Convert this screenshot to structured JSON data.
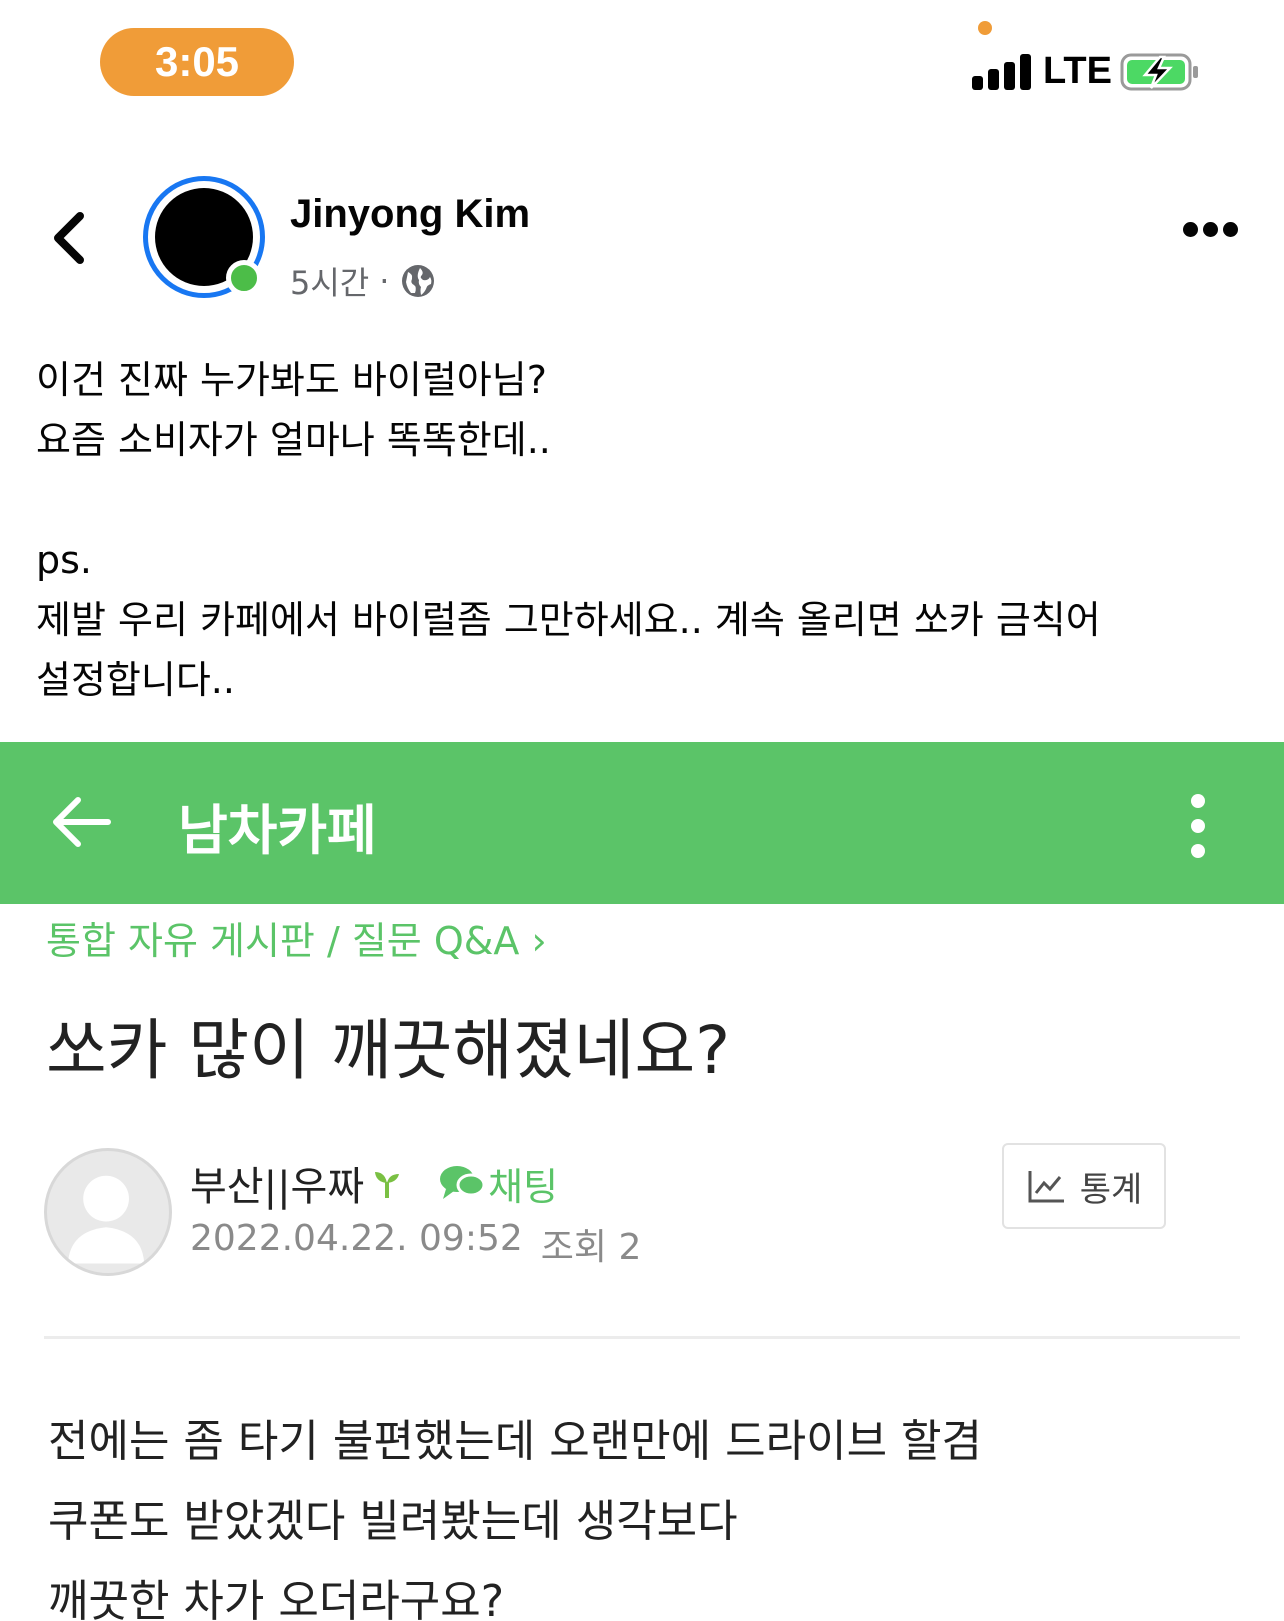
{
  "status_bar": {
    "time": "3:05",
    "network": "LTE",
    "colors": {
      "time_pill": "#f09c38",
      "battery_fill": "#4cd964"
    }
  },
  "post": {
    "author": "Jinyong Kim",
    "time_ago": "5시간",
    "separator": "·",
    "icons": [
      "back-icon",
      "globe-icon",
      "more-icon"
    ],
    "text_lines": [
      "이건 진짜 누가봐도 바이럴아님?",
      "요즘 소비자가 얼마나 똑똑한데..",
      "",
      "ps.",
      "제발 우리 카페에서 바이럴좀 그만하세요.. 계속 올리면 쏘카 금칙어",
      "설정합니다.."
    ],
    "colors": {
      "avatar_ring": "#1877f2",
      "online_dot": "#4cbd48"
    }
  },
  "embed": {
    "cafe_name": "남차카페",
    "board_path": "통합 자유 게시판 / 질문 Q&A",
    "board_chevron": "›",
    "article_title": "쏘카 많이 깨끗해졌네요?",
    "writer": "부산||우짜",
    "chat_label": "채팅",
    "date": "2022.04.22. 09:52",
    "views": "조회 2",
    "stats_label": "통계",
    "body_lines": [
      "전에는 좀 타기 불편했는데 오랜만에 드라이브 할겸",
      "쿠폰도 받았겠다 빌려봤는데 생각보다",
      "깨끗한 차가 오더라구요?"
    ],
    "colors": {
      "cafe_green": "#5bc468"
    }
  }
}
